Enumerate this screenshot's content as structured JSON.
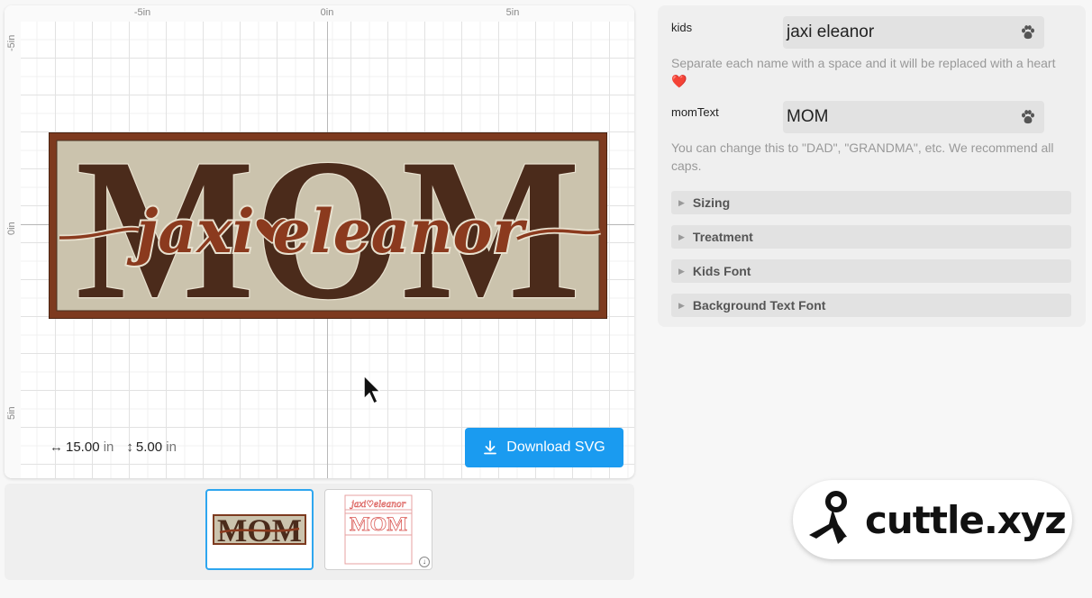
{
  "canvas": {
    "ruler_top_labels": [
      "-5in",
      "0in",
      "5in"
    ],
    "ruler_left_labels": [
      "-5in",
      "0in",
      "5in"
    ],
    "artwork": {
      "background_text": "MOM",
      "kids_text_left": "jaxi",
      "kids_text_right": "eleanor",
      "colors": {
        "border": "#7d3a1f",
        "background": "#cbc3ad",
        "letters": "#4b2b1b",
        "kids": "#8b3a1e"
      }
    },
    "dimensions": {
      "width_glyph": "↔",
      "width_value": "15.00",
      "width_unit": "in",
      "height_glyph": "↕",
      "height_value": "5.00",
      "height_unit": "in"
    },
    "download_label": "Download SVG"
  },
  "params": {
    "kids": {
      "label": "kids",
      "value": "jaxi eleanor",
      "help": "Separate each name with a space and it will be replaced with a heart ❤️"
    },
    "momText": {
      "label": "momText",
      "value": "MOM",
      "help": "You can change this to \"DAD\", \"GRANDMA\", etc. We recommend all caps."
    },
    "sections": [
      "Sizing",
      "Treatment",
      "Kids Font",
      "Background Text Font"
    ]
  },
  "thumbnails": {
    "thumb1_text": "MOM",
    "thumb2_text": "MOM",
    "thumb2_kids": "jaxi♡eleanor",
    "download_glyph": "↓"
  },
  "brand": {
    "name": "cuttle.xyz",
    "icon": "scissors-icon"
  }
}
